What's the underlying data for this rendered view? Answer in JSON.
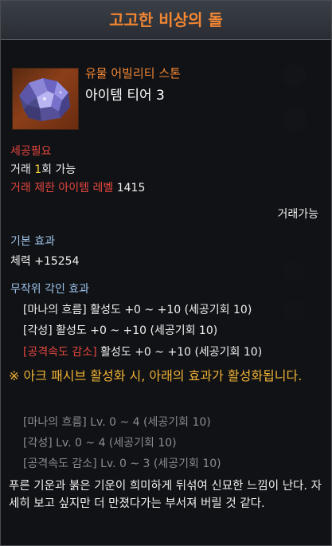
{
  "tooltip": {
    "title": "고고한 비상의 돌",
    "item_grade": "유물 어빌리티 스톤",
    "item_tier": "아이템 티어 3",
    "carve_required": "세공필요",
    "trade_prefix": "거래 ",
    "trade_count": "1",
    "trade_suffix": "회 가능",
    "trade_limit_label": "거래 제한 아이템 레벨",
    "trade_limit_value": "1415",
    "tradable": "거래가능",
    "base_effect_label": "기본 효과",
    "base_effect_value": "체력 +15254",
    "random_engrave_label": "무작위 각인 효과",
    "engravings": [
      {
        "name": "[마나의 흐름]",
        "text": " 활성도 +0 ~ +10 (세공기회 10)"
      },
      {
        "name": "[각성]",
        "text": " 활성도 +0 ~ +10 (세공기회 10)"
      },
      {
        "name": "[공격속도 감소]",
        "text": " 활성도 +0 ~ +10 (세공기회 10)"
      }
    ],
    "ark_note": "※ 아크 패시브 활성화 시, 아래의 효과가 활성화됩니다.",
    "ark_effects": [
      "[마나의 흐름] Lv. 0 ~ 4 (세공기회 10)",
      "[각성] Lv. 0 ~ 4 (세공기회 10)",
      "[공격속도 감소] Lv. 0 ~ 3 (세공기회 10)"
    ],
    "flavor_text": "푸른 기운과 붉은 기운이 희미하게 뒤섞여 신묘한 느낌이 난다. 자세히 보고 싶지만 더 만졌다가는 부서져 버릴 것 같다."
  },
  "colors": {
    "relic_orange": "#f28633",
    "red_label": "#e5473f",
    "blue_label": "#9cc3e8",
    "gold_note": "#f0b335"
  }
}
